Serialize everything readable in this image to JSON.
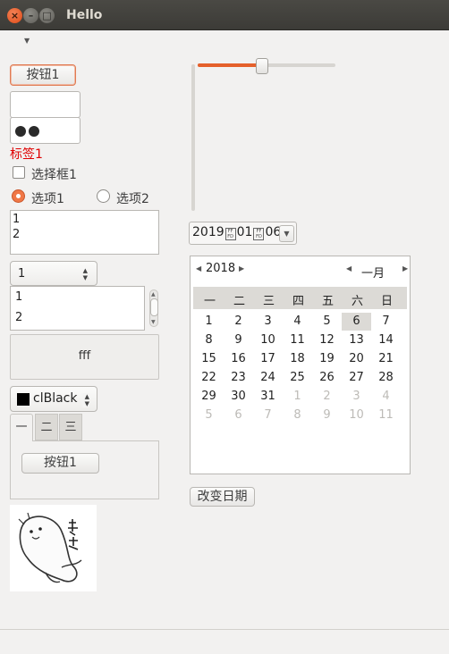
{
  "window": {
    "title": "Hello"
  },
  "left": {
    "button1_label": "按钮1",
    "text_value": "",
    "password_masked": "●●",
    "label1": "标签1",
    "checkbox_label": "选择框1",
    "radio1_label": "选项1",
    "radio2_label": "选项2",
    "memo_lines": [
      "1",
      "2"
    ],
    "spin_value": "1",
    "list_items": [
      "1",
      "2"
    ],
    "panel_text": "fff",
    "color_combo_value": "clBlack",
    "color_swatch": "#000000",
    "tabs": [
      "一",
      "二",
      "三"
    ],
    "tab_button_label": "按钮1"
  },
  "right": {
    "slider_value_pct": 47,
    "date_edit": {
      "year": "2019",
      "month": "01",
      "day": "06"
    },
    "calendar": {
      "year": "2018",
      "month": "一月",
      "weekdays": [
        "一",
        "二",
        "三",
        "四",
        "五",
        "六",
        "日"
      ],
      "selected_day": "6",
      "weeks": [
        [
          "1",
          "2",
          "3",
          "4",
          "5",
          "6",
          "7"
        ],
        [
          "8",
          "9",
          "10",
          "11",
          "12",
          "13",
          "14"
        ],
        [
          "15",
          "16",
          "17",
          "18",
          "19",
          "20",
          "21"
        ],
        [
          "22",
          "23",
          "24",
          "25",
          "26",
          "27",
          "28"
        ],
        [
          "29",
          "30",
          "31",
          "1",
          "2",
          "3",
          "4"
        ],
        [
          "5",
          "6",
          "7",
          "8",
          "9",
          "10",
          "11"
        ]
      ]
    },
    "change_date_label": "改变日期"
  },
  "colors": {
    "accent": "#e5602b",
    "label_red": "#e00000",
    "titlebar": "#3c3b37"
  }
}
